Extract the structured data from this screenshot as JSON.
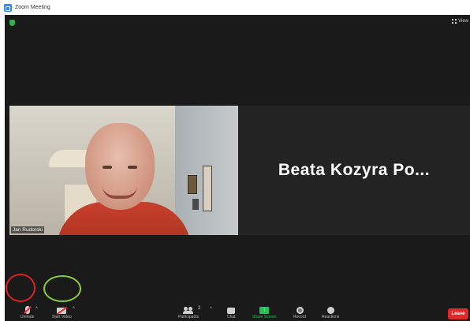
{
  "window": {
    "title": "Zoom Meeting"
  },
  "header": {
    "view_label": "View"
  },
  "participants": [
    {
      "name": "Jan Rudorski",
      "video": "on"
    },
    {
      "name": "Beata  Kozyra Po...",
      "video": "off"
    }
  ],
  "toolbar": {
    "mute_label": "Unmute",
    "video_label": "Start Video",
    "participants_label": "Participants",
    "participants_count": "2",
    "chat_label": "Chat",
    "share_label": "Share Screen",
    "record_label": "Record",
    "reactions_label": "Reactions",
    "leave_label": "Leave",
    "caret": "^"
  },
  "colors": {
    "accent_blue": "#2d8cff",
    "share_green": "#25c25a",
    "leave_red": "#e02828",
    "annotation_red": "#e02020",
    "annotation_green": "#8acb3c"
  },
  "icons": {
    "app": "zoom-app-icon",
    "security": "shield-icon",
    "view": "grid-icon",
    "mute": "mic-off-icon",
    "video": "camera-off-icon",
    "participants": "people-icon",
    "chat": "chat-icon",
    "share": "share-arrow-icon",
    "record": "record-icon",
    "reactions": "smiley-icon"
  }
}
